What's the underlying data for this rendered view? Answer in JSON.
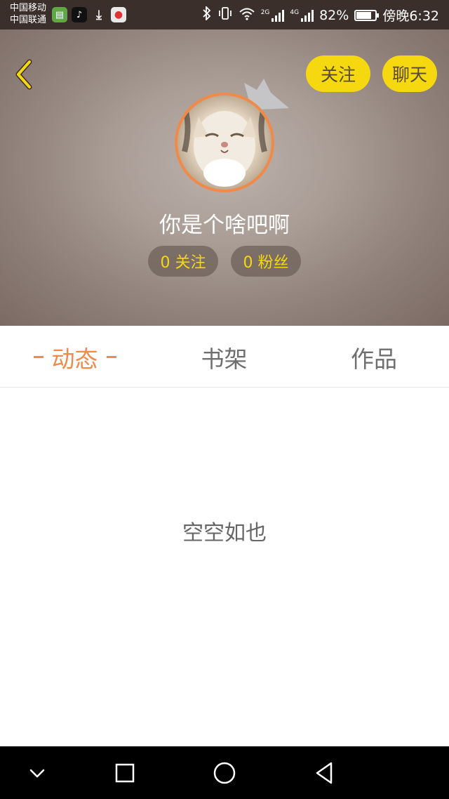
{
  "status_bar": {
    "carrier_1": "中国移动",
    "carrier_2": "中国联通",
    "net_2g": "2G",
    "net_4g": "4G",
    "battery": "82%",
    "battery_level": 0.82,
    "time": "傍晚6:32"
  },
  "header": {
    "follow_label": "关注",
    "chat_label": "聊天",
    "username": "你是个啥吧啊",
    "following_stat": "0 关注",
    "fans_stat": "0 粉丝"
  },
  "tabs": [
    {
      "label": "动态",
      "active": true
    },
    {
      "label": "书架",
      "active": false
    },
    {
      "label": "作品",
      "active": false
    }
  ],
  "content": {
    "empty_text": "空空如也"
  },
  "colors": {
    "accent": "#f08a4a",
    "yellow": "#f5d80f"
  },
  "icons": [
    "back-arrow-icon",
    "crown-icon",
    "chevron-down-icon",
    "square-icon",
    "circle-icon",
    "triangle-back-icon"
  ]
}
